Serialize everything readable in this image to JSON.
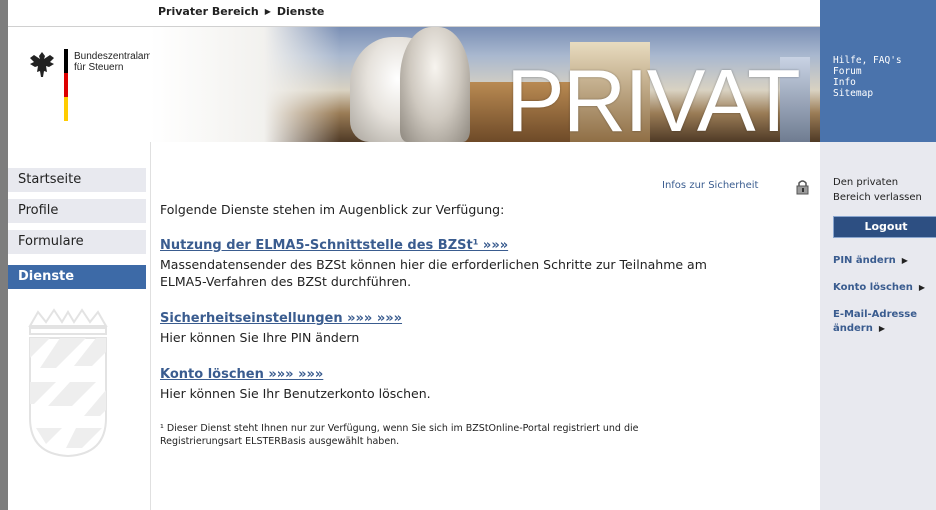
{
  "breadcrumb": {
    "part1": "Privater Bereich",
    "part2": "Dienste"
  },
  "logo": {
    "line1": "Bundeszentralamt",
    "line2": "für Steuern"
  },
  "banner": {
    "word": "PRIVAT"
  },
  "help_links": [
    "Hilfe, FAQ's",
    "Forum",
    "Info",
    "Sitemap"
  ],
  "nav": [
    {
      "label": "Startseite"
    },
    {
      "label": "Profile"
    },
    {
      "label": "Formulare"
    },
    {
      "label": "Dienste"
    }
  ],
  "right": {
    "leave_line1": "Den privaten",
    "leave_line2": "Bereich verlassen",
    "logout": "Logout",
    "pin": "PIN ändern",
    "konto": "Konto löschen",
    "email_line1": "E-Mail-Adresse",
    "email_line2": "ändern"
  },
  "main": {
    "infos_sicherheit": "Infos zur Sicherheit",
    "intro": "Folgende Dienste stehen im Augenblick zur Verfügung:",
    "services": [
      {
        "title": "Nutzung der ELMA5-Schnittstelle des BZSt¹ »»»",
        "desc1": "Massendatensender des BZSt können hier die erforderlichen Schritte zur Teilnahme am",
        "desc2": "ELMA5-Verfahren des BZSt durchführen."
      },
      {
        "title": "Sicherheitseinstellungen »»» »»»",
        "desc1": "Hier können Sie Ihre PIN ändern"
      },
      {
        "title": "Konto löschen »»» »»»",
        "desc1": "Hier können Sie Ihr Benutzerkonto löschen."
      }
    ],
    "footnote1": "¹ Dieser Dienst steht Ihnen nur zur Verfügung, wenn Sie sich im BZStOnline-Portal registriert und die",
    "footnote2": "Registrierungsart ELSTERBasis ausgewählt haben."
  },
  "colors": {
    "nav_active": "#3d6aa7",
    "link": "#3a5c8f",
    "right_header": "#4a73ac"
  }
}
